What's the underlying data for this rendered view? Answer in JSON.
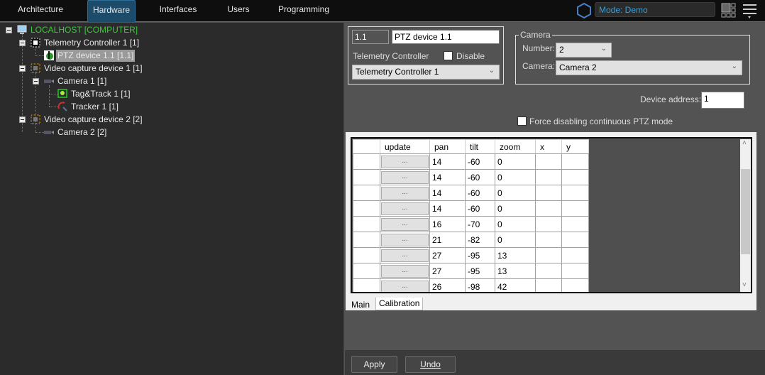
{
  "nav": {
    "tabs": [
      "Architecture",
      "Hardware",
      "Interfaces",
      "Users",
      "Programming"
    ],
    "active": "Hardware",
    "mode": "Mode: Demo"
  },
  "tree": [
    {
      "label": "LOCALHOST [COMPUTER]"
    },
    {
      "label": "Telemetry Controller 1 [1]"
    },
    {
      "label": "PTZ device 1.1 [1.1]"
    },
    {
      "label": "Video capture device 1 [1]"
    },
    {
      "label": "Camera 1 [1]"
    },
    {
      "label": "Tag&Track 1 [1]"
    },
    {
      "label": "Tracker 1 [1]"
    },
    {
      "label": "Video capture device 2 [2]"
    },
    {
      "label": "Camera 2 [2]"
    }
  ],
  "device": {
    "id": "1.1",
    "name": "PTZ device 1.1",
    "controller_label": "Telemetry Controller",
    "disable_label": "Disable",
    "disable_checked": false,
    "controller_value": "Telemetry Controller 1"
  },
  "camera": {
    "group_label": "Camera",
    "number_label": "Number:",
    "number_value": "2",
    "camera_label": "Camera:",
    "camera_value": "Camera 2"
  },
  "address": {
    "label": "Device address:",
    "value": "1"
  },
  "force": {
    "label": "Force disabling continuous PTZ mode",
    "checked": false
  },
  "grid": {
    "columns": [
      "",
      "update",
      "pan",
      "tilt",
      "zoom",
      "x",
      "y"
    ],
    "button": "...",
    "rows": [
      [
        "14",
        "-60",
        "0"
      ],
      [
        "14",
        "-60",
        "0"
      ],
      [
        "14",
        "-60",
        "0"
      ],
      [
        "14",
        "-60",
        "0"
      ],
      [
        "16",
        "-70",
        "0"
      ],
      [
        "21",
        "-82",
        "0"
      ],
      [
        "27",
        "-95",
        "13"
      ],
      [
        "27",
        "-95",
        "13"
      ],
      [
        "26",
        "-98",
        "42"
      ]
    ]
  },
  "panel_tabs": [
    "Main",
    "Calibration"
  ],
  "buttons": {
    "apply": "Apply",
    "undo": "Undo"
  },
  "colors": {
    "accent": "#3a9fd8",
    "root": "#3cc83c"
  }
}
